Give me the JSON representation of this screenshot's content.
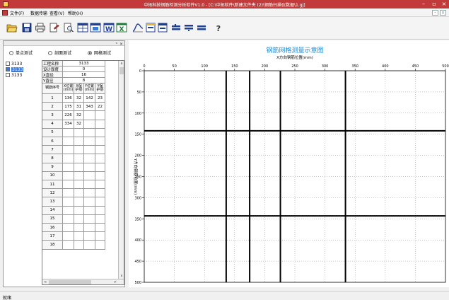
{
  "window": {
    "title": "中拓科技钢筋检测分析软件V1.0 - [C:\\中拓软件\\新建文件夹 (2)\\钢筋扫描仪数据\\1.gj]",
    "controls": [
      "–",
      "▫",
      "×"
    ]
  },
  "menu": {
    "items": [
      "文件(F)",
      "数据传输",
      "查看(V)",
      "帮助(H)"
    ],
    "mdi_controls": [
      "–",
      "▫"
    ]
  },
  "toolbar": {
    "buttons": [
      {
        "name": "open",
        "icon": "folder-open-icon"
      },
      {
        "name": "save",
        "icon": "save-disk-icon"
      },
      {
        "name": "print",
        "icon": "print-icon"
      },
      {
        "name": "print-setup",
        "icon": "print-setup-icon"
      },
      {
        "name": "print-preview",
        "icon": "print-preview-icon"
      },
      {
        "name": "table-view",
        "icon": "table-window-icon"
      },
      {
        "name": "grid-view",
        "icon": "grid-window-icon"
      },
      {
        "name": "word-export",
        "icon": "word-icon"
      },
      {
        "name": "excel-export",
        "icon": "excel-icon"
      },
      {
        "name": "analysis",
        "icon": "curve-icon"
      },
      {
        "name": "window-1",
        "icon": "window-icon"
      },
      {
        "name": "window-2",
        "icon": "window-icon"
      },
      {
        "name": "arrange-1",
        "icon": "bars-icon"
      },
      {
        "name": "arrange-2",
        "icon": "bars-icon"
      },
      {
        "name": "arrange-3",
        "icon": "bars-icon"
      },
      {
        "name": "help",
        "icon": "help-icon"
      }
    ]
  },
  "left_panel": {
    "close_glyph": "×",
    "pin_glyph": "ⁿ",
    "modes": [
      {
        "label": "单点测试",
        "selected": false
      },
      {
        "label": "剖面测试",
        "selected": false
      },
      {
        "label": "网格测试",
        "selected": true
      }
    ],
    "files": [
      {
        "label": "3133",
        "checked": false,
        "selected": false
      },
      {
        "label": "3133",
        "checked": true,
        "selected": true
      },
      {
        "label": "3133",
        "checked": false,
        "selected": false
      }
    ],
    "params": [
      {
        "label": "工程名称",
        "value": "3133"
      },
      {
        "label": "设计厚度",
        "value": "0"
      },
      {
        "label": "X直径",
        "value": "16"
      },
      {
        "label": "Y直径",
        "value": "8"
      }
    ],
    "headers": [
      "钢筋序号",
      "X位置\n(mm)",
      "X保\n护层",
      "Y位置\n(mm)",
      "Y保\n护层"
    ],
    "rows": [
      [
        "1",
        "136",
        "32",
        "142",
        "23"
      ],
      [
        "2",
        "175",
        "31",
        "343",
        "22"
      ],
      [
        "3",
        "226",
        "32",
        "",
        ""
      ],
      [
        "4",
        "334",
        "32",
        "",
        ""
      ],
      [
        "5",
        "",
        "",
        "",
        ""
      ],
      [
        "6",
        "",
        "",
        "",
        ""
      ],
      [
        "7",
        "",
        "",
        "",
        ""
      ],
      [
        "8",
        "",
        "",
        "",
        ""
      ],
      [
        "9",
        "",
        "",
        "",
        ""
      ],
      [
        "10",
        "",
        "",
        "",
        ""
      ],
      [
        "11",
        "",
        "",
        "",
        ""
      ],
      [
        "12",
        "",
        "",
        "",
        ""
      ],
      [
        "13",
        "",
        "",
        "",
        ""
      ],
      [
        "14",
        "",
        "",
        "",
        ""
      ],
      [
        "15",
        "",
        "",
        "",
        ""
      ],
      [
        "16",
        "",
        "",
        "",
        ""
      ],
      [
        "17",
        "",
        "",
        "",
        ""
      ],
      [
        "18",
        "",
        "",
        "",
        ""
      ]
    ],
    "scroll_glyphs": {
      "up": "∧",
      "down": "∨",
      "left": "<",
      "right": ">"
    }
  },
  "chart_data": {
    "type": "grid",
    "title": "钢筋网格测量示意图",
    "xlabel": "X方向钢筋位置(mm)",
    "ylabel": "Y方向钢筋位置(mm)",
    "xlim": [
      0,
      500
    ],
    "ylim": [
      0,
      500
    ],
    "y_inverted": true,
    "xticks": [
      0,
      50,
      100,
      150,
      200,
      250,
      300,
      350,
      400,
      450,
      500
    ],
    "yticks": [
      0,
      50,
      100,
      150,
      200,
      250,
      300,
      350,
      400,
      450,
      500
    ],
    "grid": "dotted",
    "x_bars": [
      136,
      175,
      226,
      334
    ],
    "y_bars": [
      142,
      343
    ],
    "bar_color": "#000000",
    "title_color": "#1f8fd6"
  },
  "status": {
    "text": "就绪"
  }
}
